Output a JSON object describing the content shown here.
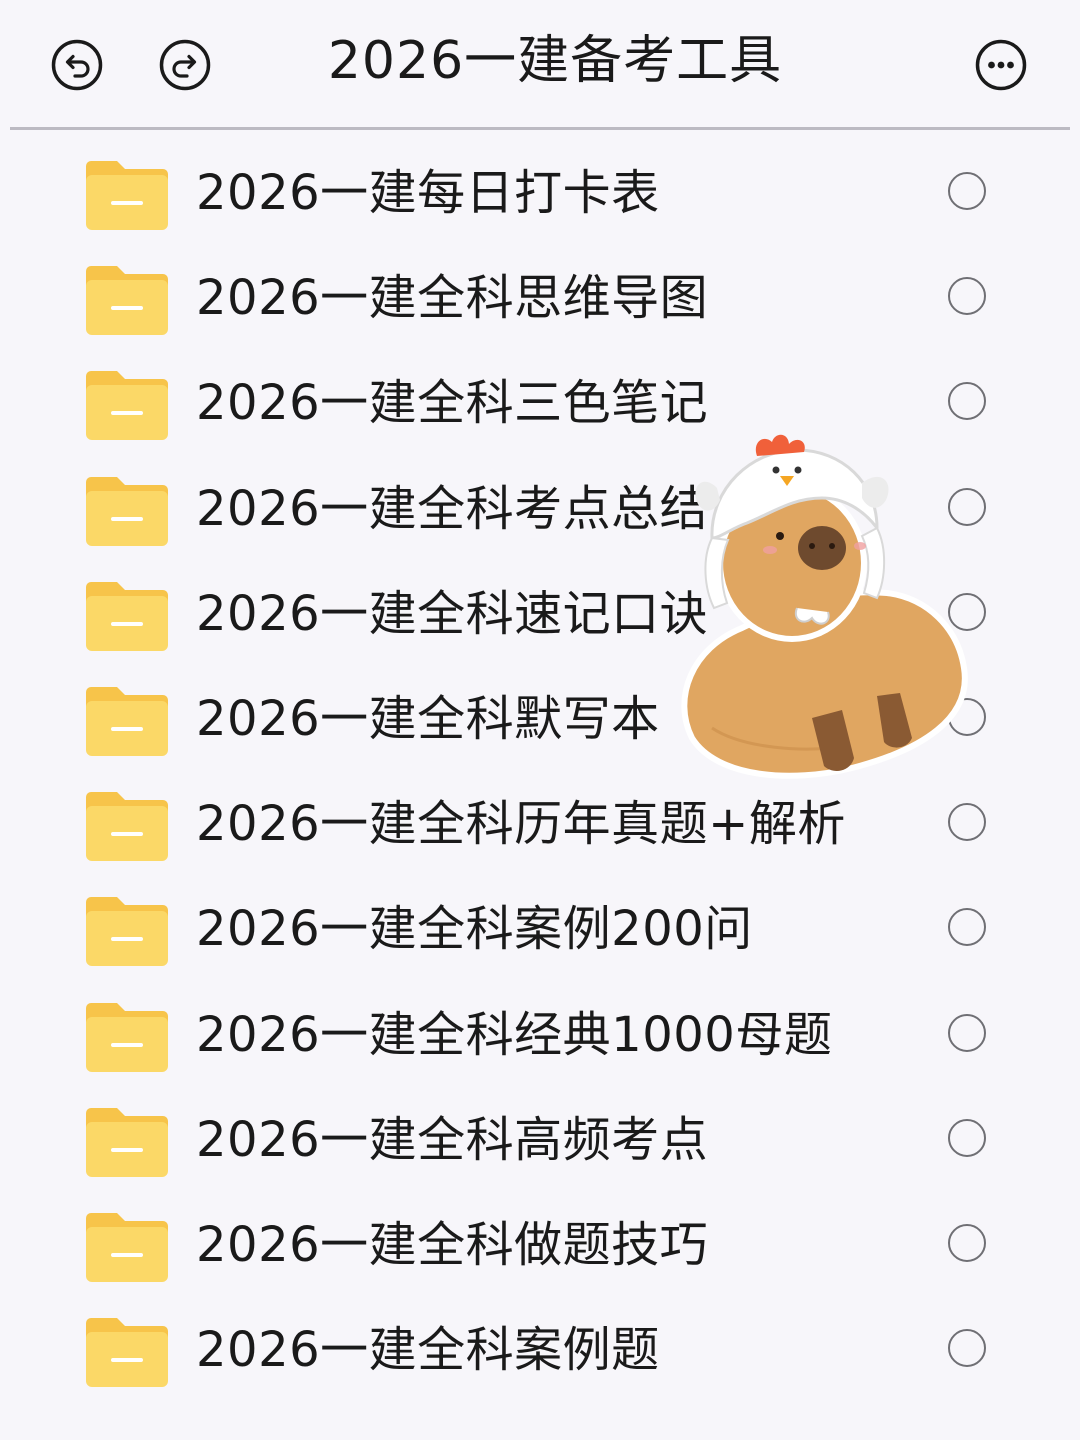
{
  "header": {
    "title": "2026一建备考工具",
    "icons": {
      "undo": "undo-arrow-icon",
      "redo": "redo-arrow-icon",
      "more": "more-options-icon"
    }
  },
  "list": {
    "items": [
      {
        "label": "2026一建每日打卡表",
        "icon": "folder-icon",
        "selected": false
      },
      {
        "label": "2026一建全科思维导图",
        "icon": "folder-icon",
        "selected": false
      },
      {
        "label": "2026一建全科三色笔记",
        "icon": "folder-icon",
        "selected": false
      },
      {
        "label": "2026一建全科考点总结",
        "icon": "folder-icon",
        "selected": false
      },
      {
        "label": "2026一建全科速记口诀",
        "icon": "folder-icon",
        "selected": false
      },
      {
        "label": "2026一建全科默写本",
        "icon": "folder-icon",
        "selected": false
      },
      {
        "label": "2026一建全科历年真题+解析",
        "icon": "folder-icon",
        "selected": false
      },
      {
        "label": "2026一建全科案例200问",
        "icon": "folder-icon",
        "selected": false
      },
      {
        "label": "2026一建全科经典1000母题",
        "icon": "folder-icon",
        "selected": false
      },
      {
        "label": "2026一建全科高频考点",
        "icon": "folder-icon",
        "selected": false
      },
      {
        "label": "2026一建全科做题技巧",
        "icon": "folder-icon",
        "selected": false
      },
      {
        "label": "2026一建全科案例题",
        "icon": "folder-icon",
        "selected": false
      }
    ]
  },
  "colors": {
    "folder_back": "#f7c44a",
    "folder_front": "#fbd867",
    "folder_bar": "#ffffff",
    "radio_border": "#6f6f74",
    "divider": "#bcbac2",
    "background": "#f7f6fa"
  },
  "decoration": {
    "sticker": "capybara-chicken-hat-sticker"
  }
}
